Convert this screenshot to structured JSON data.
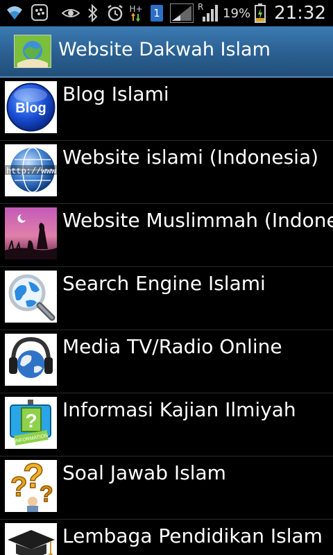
{
  "status_bar": {
    "network_type": "H+",
    "sim_slot": "1",
    "roaming": "R",
    "battery_percent": "19%",
    "time": "21:32"
  },
  "header": {
    "title": "Website Dakwah Islam"
  },
  "list": {
    "items": [
      {
        "label": "Blog Islami",
        "icon": "blog-icon",
        "blog_text": "Blog"
      },
      {
        "label": "Website islami (Indonesia)",
        "icon": "globe-www-icon",
        "url_text": "http://www"
      },
      {
        "label": "Website Muslimmah (Indonesia)",
        "icon": "silhouette-moon-icon"
      },
      {
        "label": "Search Engine Islami",
        "icon": "magnifier-globe-icon"
      },
      {
        "label": "Media TV/Radio Online",
        "icon": "headphones-globe-icon"
      },
      {
        "label": "Informasi Kajian Ilmiyah",
        "icon": "information-sign-icon",
        "sign_text": "INFORMATION"
      },
      {
        "label": "Soal Jawab Islam",
        "icon": "question-marks-icon"
      },
      {
        "label": "Lembaga Pendidikan Islam",
        "icon": "graduation-cap-icon"
      }
    ]
  }
}
